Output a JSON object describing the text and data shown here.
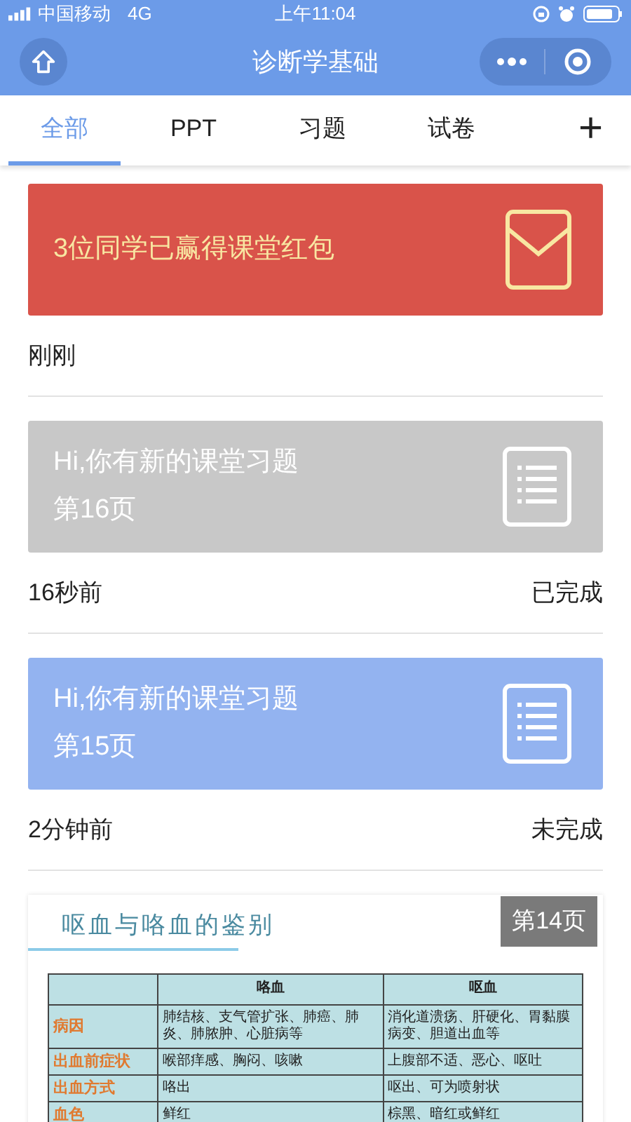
{
  "status_bar": {
    "carrier": "中国移动",
    "network": "4G",
    "time": "上午11:04"
  },
  "nav": {
    "title": "诊断学基础"
  },
  "tabs": [
    {
      "label": "全部",
      "selected": true
    },
    {
      "label": "PPT",
      "selected": false
    },
    {
      "label": "习题",
      "selected": false
    },
    {
      "label": "试卷",
      "selected": false
    }
  ],
  "add_tab": {
    "label": "+"
  },
  "feed": [
    {
      "kind": "redpacket",
      "title": "3位同学已赢得课堂红包",
      "time": "刚刚"
    },
    {
      "kind": "exercise",
      "title": "Hi,你有新的课堂习题",
      "page": "第16页",
      "time": "16秒前",
      "status": "已完成",
      "completed": true
    },
    {
      "kind": "exercise",
      "title": "Hi,你有新的课堂习题",
      "page": "第15页",
      "time": "2分钟前",
      "status": "未完成",
      "completed": false
    },
    {
      "kind": "slide",
      "page": "第14页",
      "slide_title": "呕血与咯血的鉴别",
      "header": [
        "咯血",
        "呕血"
      ],
      "rows": [
        {
          "label": "病因",
          "cells": [
            "肺结核、支气管扩张、肺癌、肺炎、肺脓肿、心脏病等",
            "消化道溃疡、肝硬化、胃黏膜病变、胆道出血等"
          ]
        },
        {
          "label": "出血前症状",
          "cells": [
            "喉部痒感、胸闷、咳嗽",
            "上腹部不适、恶心、呕吐"
          ]
        },
        {
          "label": "出血方式",
          "cells": [
            "咯出",
            "呕出、可为喷射状"
          ]
        },
        {
          "label": "血色",
          "cells": [
            "鲜红",
            "棕黑、暗红或鲜红"
          ]
        }
      ]
    }
  ]
}
